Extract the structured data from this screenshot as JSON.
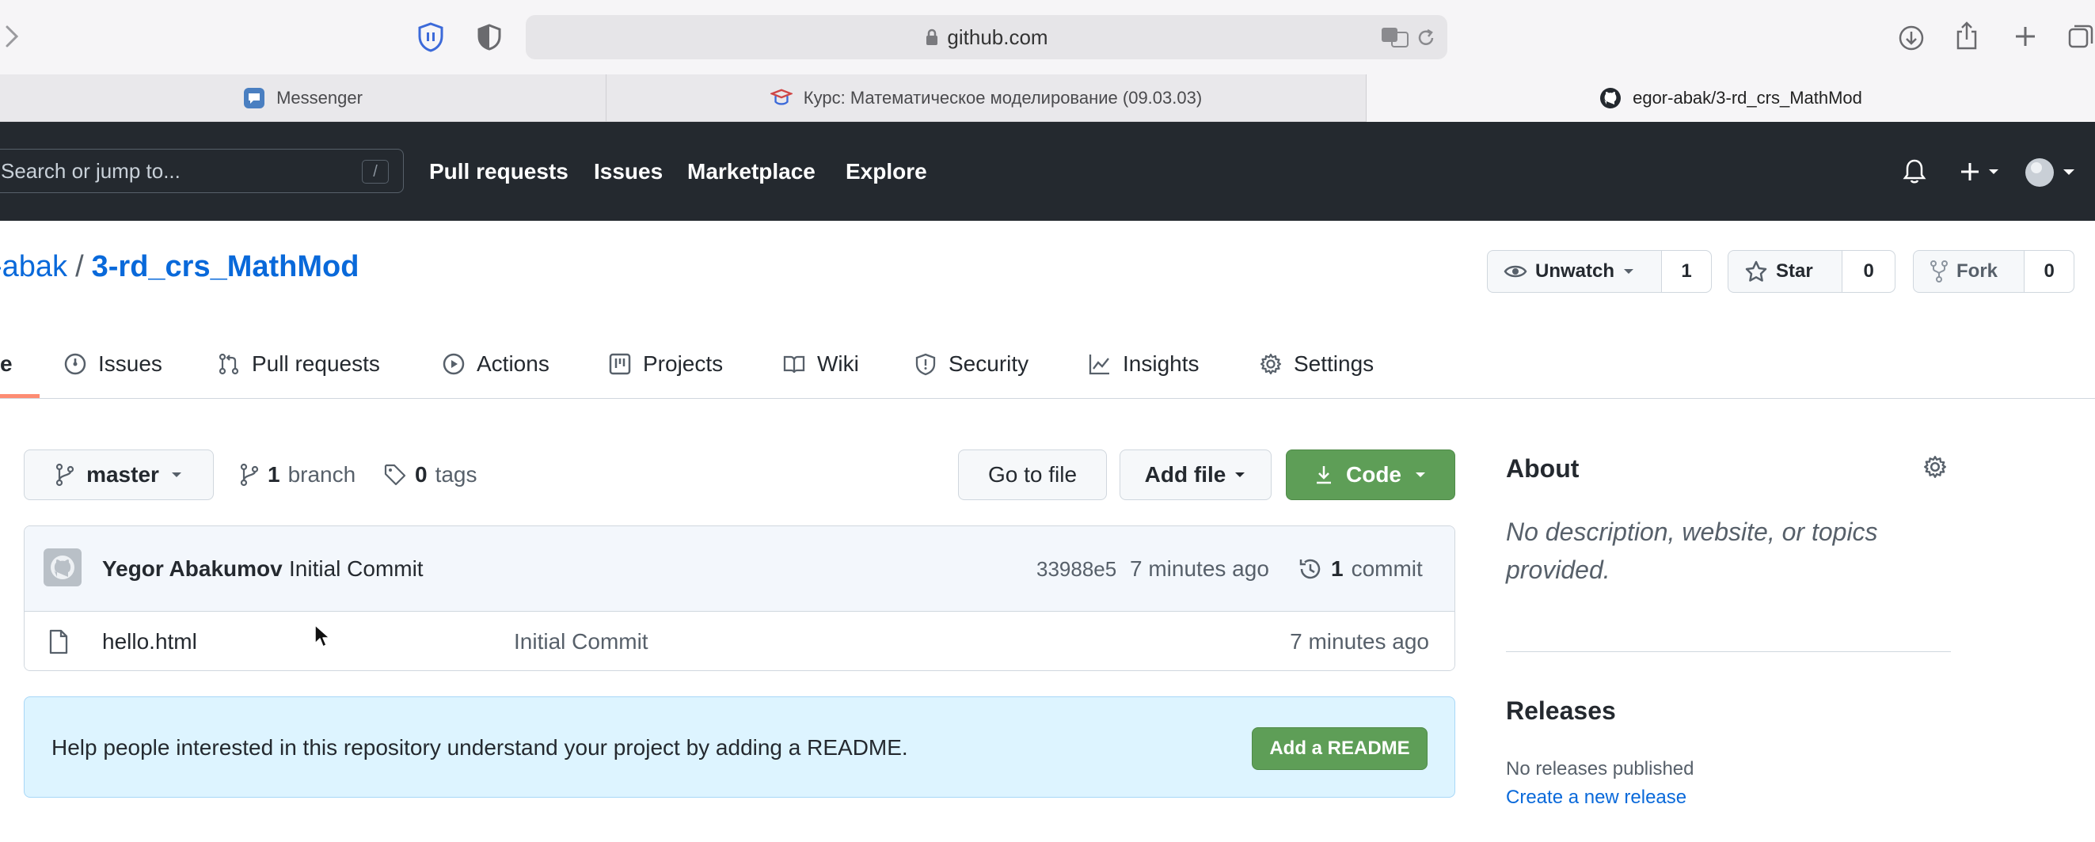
{
  "browser": {
    "url": "github.com",
    "tabs": [
      {
        "label": "Messenger"
      },
      {
        "label": "Курс: Математическое моделирование (09.03.03)"
      },
      {
        "label": "egor-abak/3-rd_crs_MathMod"
      }
    ]
  },
  "header": {
    "search_placeholder": "Search or jump to...",
    "search_shortcut": "/",
    "nav": [
      "Pull requests",
      "Issues",
      "Marketplace",
      "Explore"
    ]
  },
  "repo": {
    "owner": "-abak",
    "separator": "/",
    "name": "3-rd_crs_MathMod",
    "unwatch_label": "Unwatch",
    "watch_count": "1",
    "star_label": "Star",
    "star_count": "0",
    "fork_label": "Fork",
    "fork_count": "0"
  },
  "tabs": {
    "code_partial": "e",
    "issues": "Issues",
    "pull_requests": "Pull requests",
    "actions": "Actions",
    "projects": "Projects",
    "wiki": "Wiki",
    "security": "Security",
    "insights": "Insights",
    "settings": "Settings"
  },
  "toolbar": {
    "branch": "master",
    "branch_count": "1",
    "branch_label": "branch",
    "tag_count": "0",
    "tag_label": "tags",
    "go_to_file": "Go to file",
    "add_file": "Add file",
    "code": "Code"
  },
  "commit": {
    "author": "Yegor Abakumov",
    "message": "Initial Commit",
    "hash": "33988e5",
    "time": "7 minutes ago",
    "count": "1",
    "count_label": "commit"
  },
  "files": [
    {
      "name": "hello.html",
      "message": "Initial Commit",
      "time": "7 minutes ago"
    }
  ],
  "readme_banner": {
    "text": "Help people interested in this repository understand your project by adding a README.",
    "button": "Add a README"
  },
  "sidebar": {
    "about_title": "About",
    "about_text": "No description, website, or topics provided.",
    "releases_title": "Releases",
    "releases_text": "No releases published",
    "create_release": "Create a new release"
  },
  "colors": {
    "header_bg": "#24292f",
    "link": "#0969da",
    "green_button": "#5e9e57",
    "tab_underline": "#fd8c73",
    "readme_bg": "#ddf4ff"
  }
}
